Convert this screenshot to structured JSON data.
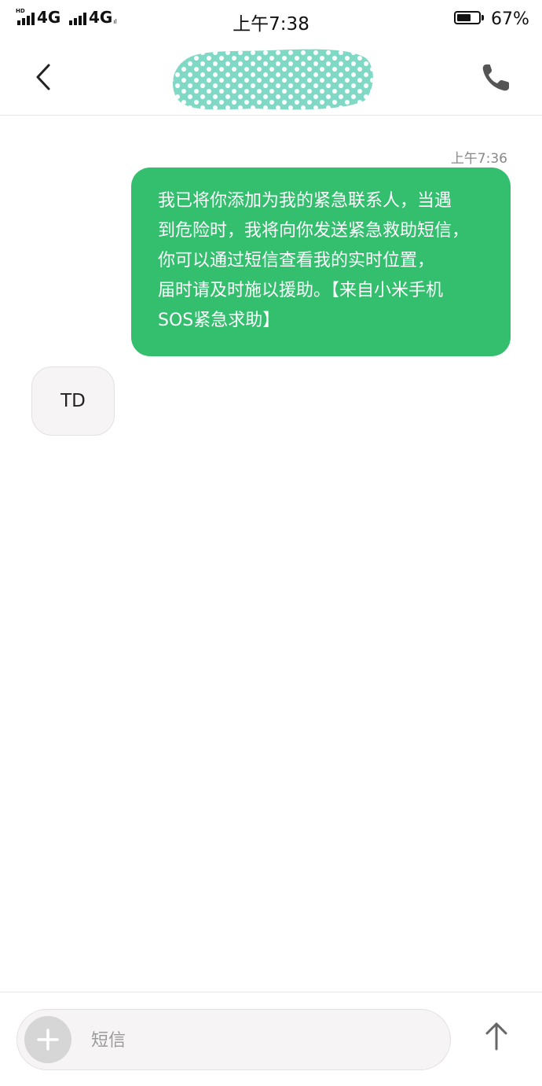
{
  "status_bar": {
    "hd_label": "HD",
    "network_1": "4G",
    "network_2": "4G",
    "network_2_sub": "ıl",
    "time": "上午7:38",
    "battery_percent": "67%",
    "battery_level": 0.67
  },
  "header": {
    "back_icon": "chevron-left-icon",
    "contact_name": "",
    "call_icon": "phone-icon"
  },
  "conversation": {
    "messages": [
      {
        "direction": "outgoing",
        "timestamp": "上午7:36",
        "lines": [
          "我已将你添加为我的紧急联系人，当遇",
          "到危险时，我将向你发送紧急救助短信，",
          "你可以通过短信查看我的实时位置，",
          "届时请及时施以援助。【来自小米手机",
          "SOS紧急求助】"
        ]
      },
      {
        "direction": "incoming",
        "text": "TD"
      }
    ]
  },
  "composer": {
    "attach_icon": "plus-icon",
    "placeholder": "短信",
    "send_icon": "arrow-up-icon"
  },
  "colors": {
    "outgoing_bubble": "#33bf6d",
    "incoming_bubble": "#f7f4f6",
    "contact_blur": "#7fd9c4"
  }
}
